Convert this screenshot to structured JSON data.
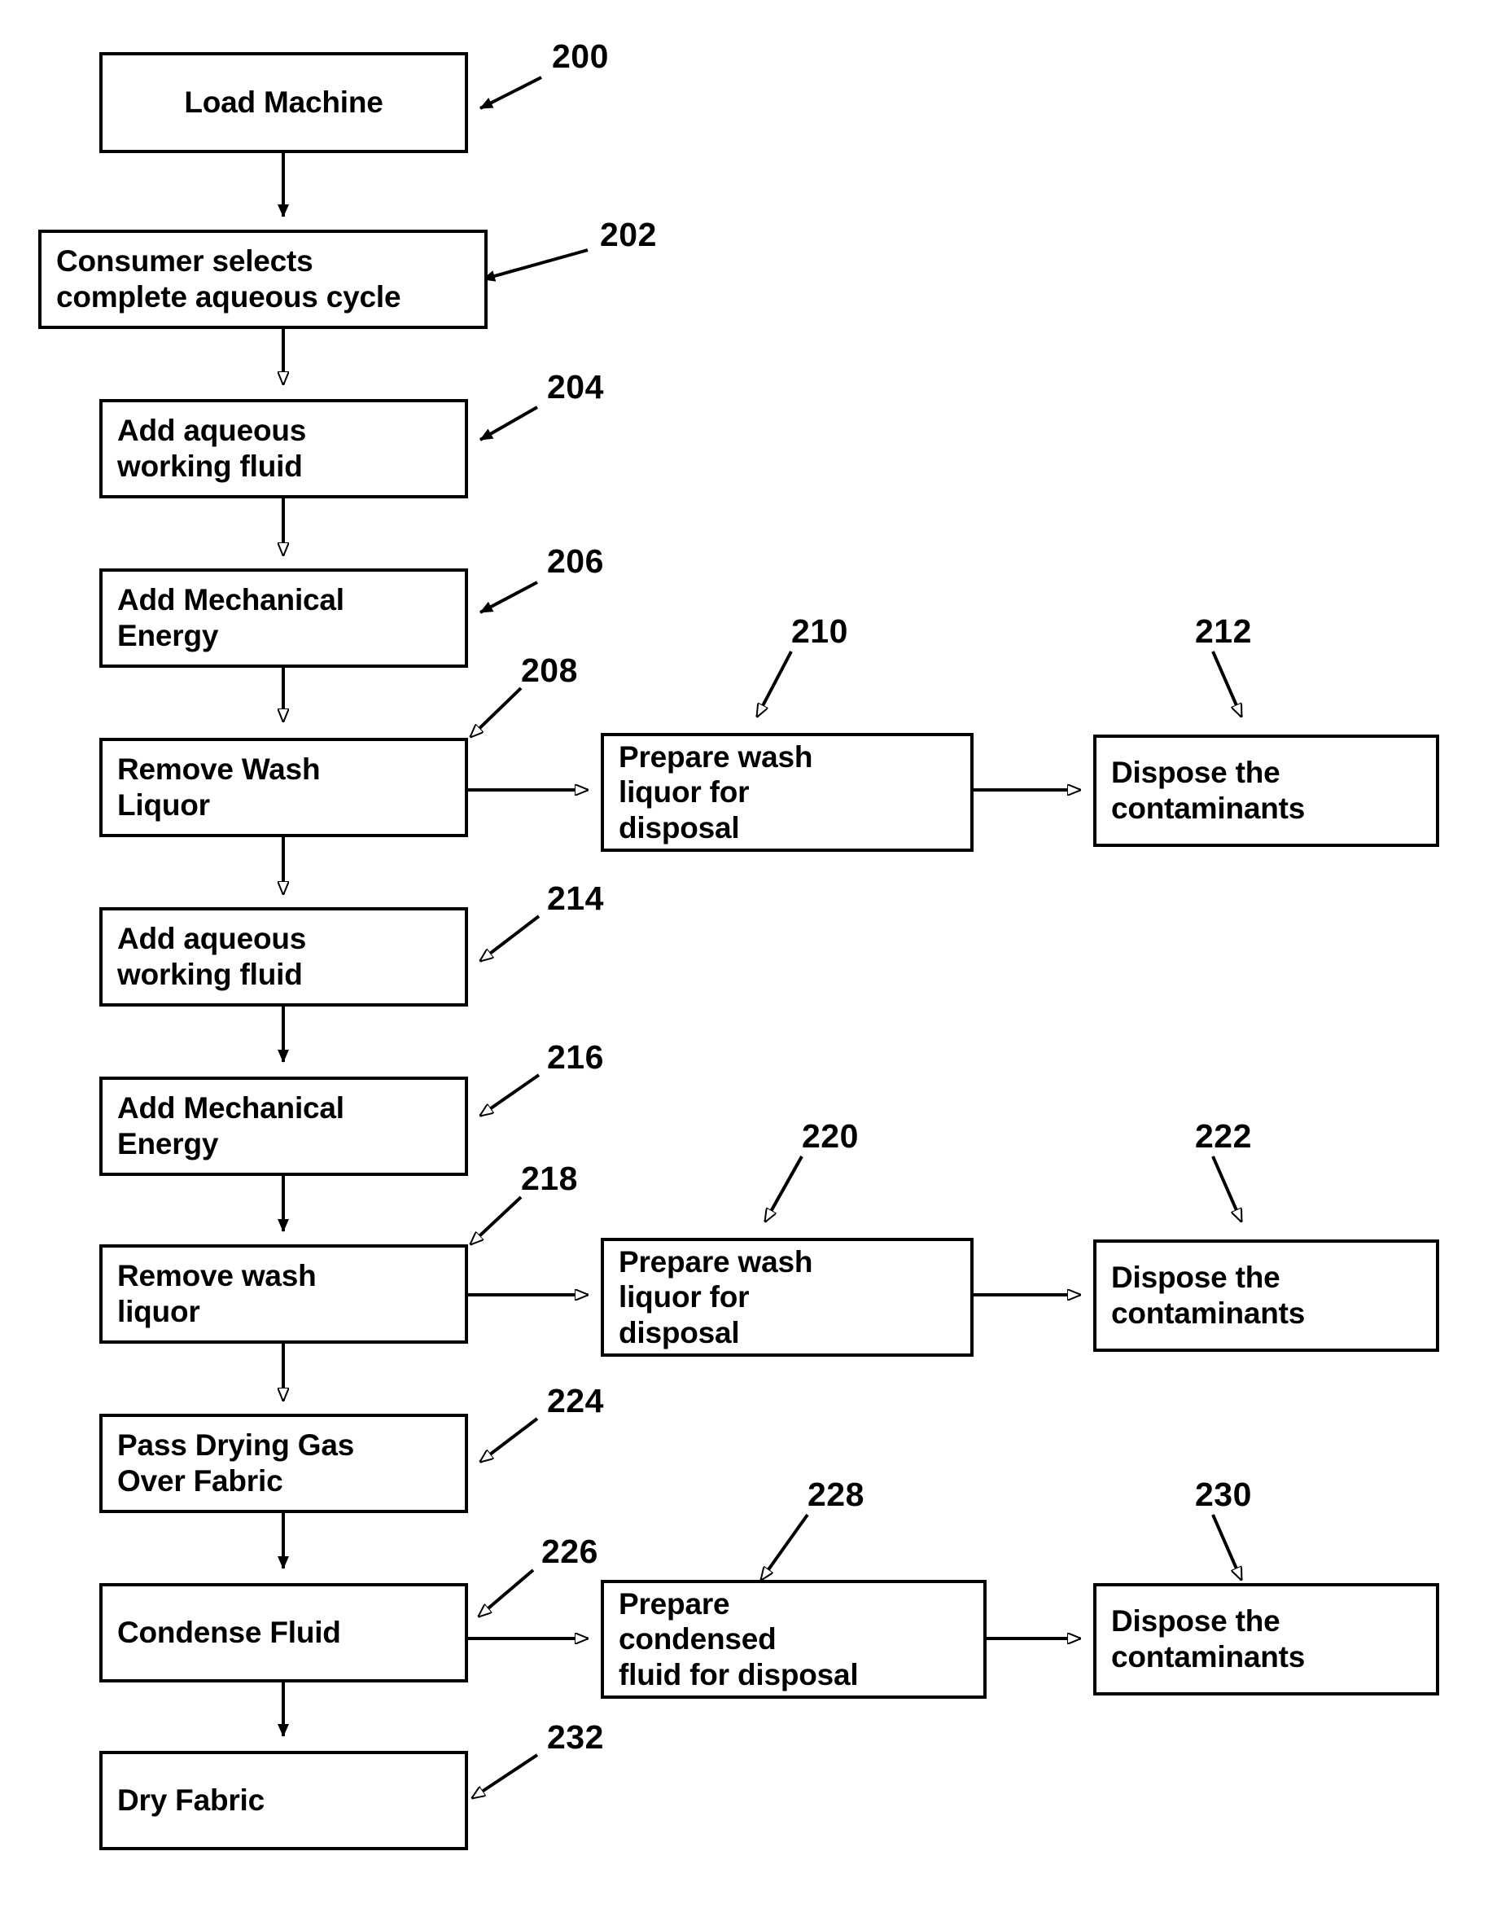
{
  "diagram": {
    "title": "Aqueous fabric cleaning and drying process flowchart",
    "line_color": "#000000",
    "background_color": "#ffffff",
    "nodes": [
      {
        "ref": "200",
        "text": "Load Machine",
        "align": "center"
      },
      {
        "ref": "202",
        "text": "Consumer selects\ncomplete aqueous cycle",
        "align": "left"
      },
      {
        "ref": "204",
        "text": "Add aqueous\nworking fluid",
        "align": "left"
      },
      {
        "ref": "206",
        "text": "Add Mechanical\nEnergy",
        "align": "left"
      },
      {
        "ref": "208",
        "text": "Remove Wash\nLiquor",
        "align": "left"
      },
      {
        "ref": "210",
        "text": "Prepare wash\nliquor for\ndisposal",
        "align": "left"
      },
      {
        "ref": "212",
        "text": "Dispose the\ncontaminants",
        "align": "left"
      },
      {
        "ref": "214",
        "text": "Add aqueous\nworking fluid",
        "align": "left"
      },
      {
        "ref": "216",
        "text": "Add Mechanical\nEnergy",
        "align": "left"
      },
      {
        "ref": "218",
        "text": "Remove wash\nliquor",
        "align": "left"
      },
      {
        "ref": "220",
        "text": "Prepare wash\nliquor for\ndisposal",
        "align": "left"
      },
      {
        "ref": "222",
        "text": "Dispose the\ncontaminants",
        "align": "left"
      },
      {
        "ref": "224",
        "text": "Pass Drying Gas\nOver Fabric",
        "align": "left"
      },
      {
        "ref": "226",
        "text": "Condense Fluid",
        "align": "left"
      },
      {
        "ref": "228",
        "text": "Prepare\ncondensed\nfluid for disposal",
        "align": "left"
      },
      {
        "ref": "230",
        "text": "Dispose the\ncontaminants",
        "align": "left"
      },
      {
        "ref": "232",
        "text": "Dry Fabric",
        "align": "left"
      }
    ],
    "reference_numerals": [
      "200",
      "202",
      "204",
      "206",
      "208",
      "210",
      "212",
      "214",
      "216",
      "218",
      "220",
      "222",
      "224",
      "226",
      "228",
      "230",
      "232"
    ]
  }
}
